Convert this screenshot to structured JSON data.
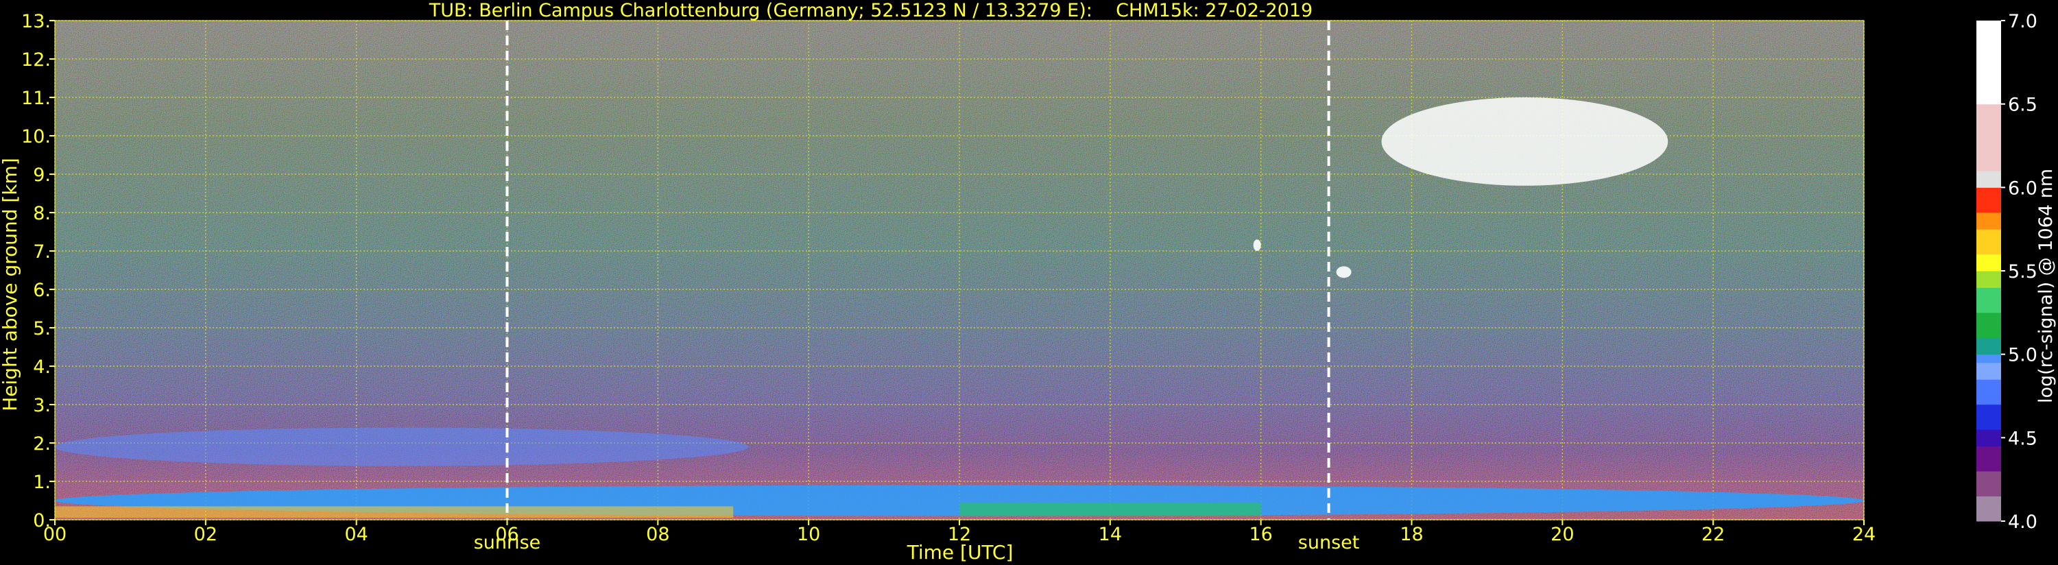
{
  "chart_data": {
    "type": "heatmap",
    "title": "TUB: Berlin Campus Charlottenburg (Germany; 52.5123 N / 13.3279 E):    CHM15k: 27-02-2019",
    "xlabel": "Time [UTC]",
    "ylabel": "Height above ground [km]",
    "xlim": [
      0,
      24
    ],
    "ylim": [
      0,
      13
    ],
    "x_ticks": [
      "00",
      "02",
      "04",
      "06",
      "08",
      "10",
      "12",
      "14",
      "16",
      "18",
      "20",
      "22",
      "24"
    ],
    "y_ticks": [
      "0.",
      "1.",
      "2.",
      "3.",
      "4.",
      "5.",
      "6.",
      "7.",
      "8.",
      "9.",
      "10.",
      "11.",
      "12.",
      "13."
    ],
    "grid": true,
    "markers": [
      {
        "label": "sunrise",
        "x": 6.0
      },
      {
        "label": "sunset",
        "x": 16.9
      }
    ],
    "colorbar": {
      "label": "log(rc-signal) @ 1064 nm",
      "range": [
        4.0,
        7.0
      ],
      "ticks": [
        "4.0",
        "4.5",
        "5.0",
        "5.5",
        "6.0",
        "6.5",
        "7.0"
      ]
    },
    "features": [
      {
        "kind": "boundary-layer",
        "x_range": [
          0,
          24
        ],
        "height_km": [
          0.1,
          0.9
        ]
      },
      {
        "kind": "residual-aerosol-layer",
        "x_range": [
          0,
          9.2
        ],
        "height_km": [
          1.4,
          2.4
        ]
      },
      {
        "kind": "cirrus-cloud",
        "x_range": [
          17.6,
          21.4
        ],
        "height_km": [
          8.7,
          11.0
        ]
      },
      {
        "kind": "isolated-cloud",
        "x_range": [
          15.9,
          16.0
        ],
        "height_km": [
          7.0,
          7.3
        ]
      },
      {
        "kind": "isolated-cloud",
        "x_range": [
          17.0,
          17.2
        ],
        "height_km": [
          6.3,
          6.6
        ]
      }
    ]
  },
  "colors": {
    "text": "#ffff33",
    "grid": "#cccc33",
    "marker": "#ffffff",
    "colorbar_text": "#ffffff"
  }
}
